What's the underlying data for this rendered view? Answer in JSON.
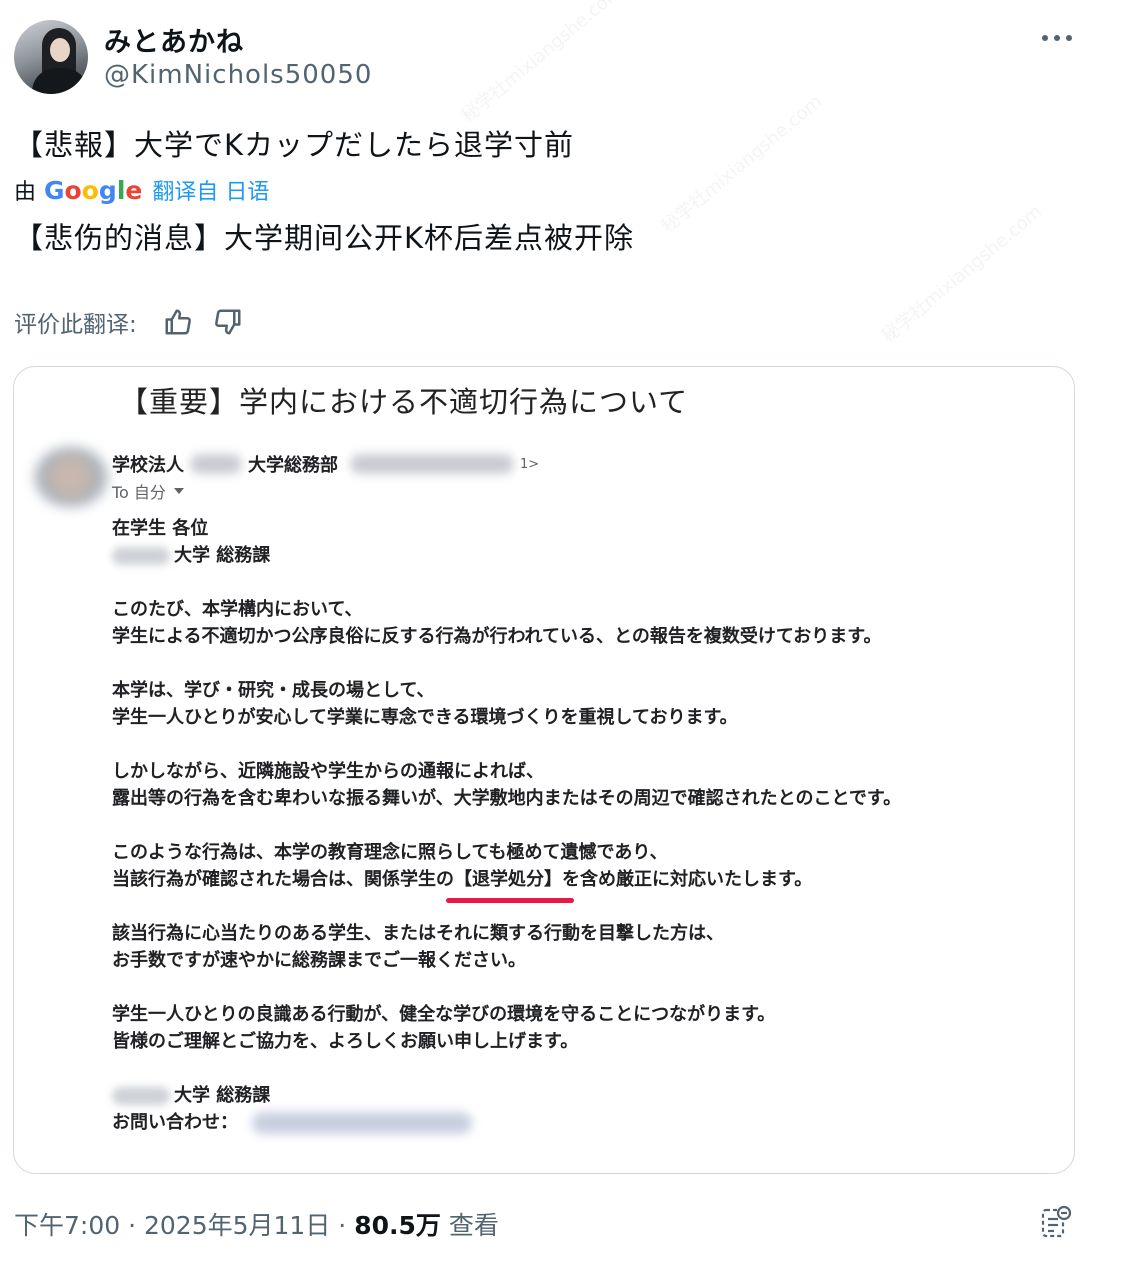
{
  "post": {
    "display_name": "みとあかね",
    "handle": "@KimNichols50050",
    "original_text": "【悲報】大学でKカップだしたら退学寸前",
    "translated_by_prefix": "由",
    "google_logo": "Google",
    "translated_from": "翻译自 日语",
    "translated_text": "【悲伤的消息】大学期间公开K杯后差点被开除",
    "rate_label": "评价此翻译:",
    "icons": [
      "more-icon",
      "thumbs-up-icon",
      "thumbs-down-icon",
      "grok-icon"
    ]
  },
  "email": {
    "subject": "【重要】学内における不適切行為について",
    "sender_prefix": "学校法人",
    "sender_org": "大学総務部",
    "sender_addr_end": "1>",
    "to_label": "To 自分",
    "greeting": "在学生 各位",
    "dept": "大学 総務課",
    "p1_l1": "このたび、本学構内において、",
    "p1_l2": "学生による不適切かつ公序良俗に反する行為が行われている、との報告を複数受けております。",
    "p2_l1": "本学は、学び・研究・成長の場として、",
    "p2_l2": "学生一人ひとりが安心して学業に専念できる環境づくりを重視しております。",
    "p3_l1": "しかしながら、近隣施設や学生からの通報によれば、",
    "p3_l2": "露出等の行為を含む卑わいな振る舞いが、大学敷地内またはその周辺で確認されたとのことです。",
    "p4_l1": "このような行為は、本学の教育理念に照らしても極めて遺憾であり、",
    "p4_l2_a": "当該行為が確認された場合は、関係学生の",
    "p4_l2_highlight": "【退学処分】",
    "p4_l2_b": "を含め厳正に対応いたします。",
    "p5_l1": "該当行為に心当たりのある学生、またはそれに類する行動を目撃した方は、",
    "p5_l2": "お手数ですが速やかに総務課までご一報ください。",
    "p6_l1": "学生一人ひとりの良識ある行動が、健全な学びの環境を守ることにつながります。",
    "p6_l2": "皆様のご理解とご協力を、よろしくお願い申し上げます。",
    "sign_dept": "大学 総務課",
    "contact_label": "お問い合わせ："
  },
  "footer": {
    "time": "下午7:00 · 2025年5月11日 ·",
    "views": "80.5万",
    "views_label": "查看"
  },
  "colors": {
    "accent": "#1d9bf0",
    "muted": "#536471",
    "highlight_underline": "#e8194a"
  }
}
